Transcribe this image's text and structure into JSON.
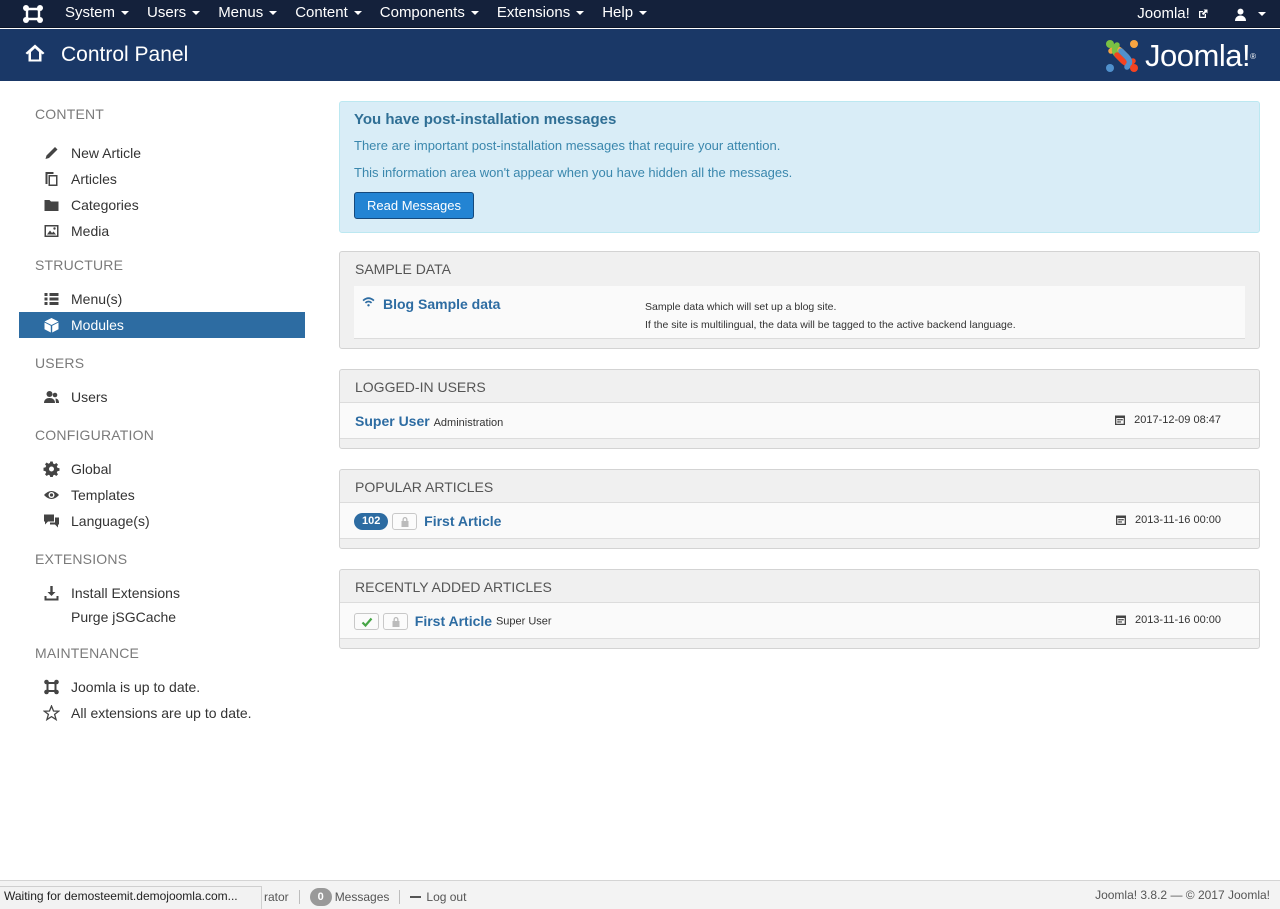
{
  "topnav": {
    "menu": [
      "System",
      "Users",
      "Menus",
      "Content",
      "Components",
      "Extensions",
      "Help"
    ],
    "site_link": "Joomla!"
  },
  "header": {
    "title": "Control Panel",
    "brand": "Joomla!",
    "brand_mark": "®"
  },
  "sidebar": {
    "sections": [
      {
        "heading": "CONTENT",
        "items": [
          {
            "label": "New Article",
            "icon": "pencil-icon"
          },
          {
            "label": "Articles",
            "icon": "copy-icon"
          },
          {
            "label": "Categories",
            "icon": "folder-icon"
          },
          {
            "label": "Media",
            "icon": "image-icon"
          }
        ]
      },
      {
        "heading": "STRUCTURE",
        "items": [
          {
            "label": "Menu(s)",
            "icon": "list-icon"
          },
          {
            "label": "Modules",
            "icon": "cube-icon",
            "active": true
          }
        ]
      },
      {
        "heading": "USERS",
        "items": [
          {
            "label": "Users",
            "icon": "users-icon"
          }
        ]
      },
      {
        "heading": "CONFIGURATION",
        "items": [
          {
            "label": "Global",
            "icon": "gear-icon"
          },
          {
            "label": "Templates",
            "icon": "eye-icon"
          },
          {
            "label": "Language(s)",
            "icon": "comments-icon"
          }
        ]
      },
      {
        "heading": "EXTENSIONS",
        "items": [
          {
            "label": "Install Extensions",
            "icon": "download-icon"
          },
          {
            "label": "Purge jSGCache",
            "icon": ""
          }
        ]
      },
      {
        "heading": "MAINTENANCE",
        "items": [
          {
            "label": "Joomla is up to date.",
            "icon": "joomla-icon"
          },
          {
            "label": "All extensions are up to date.",
            "icon": "star-icon"
          }
        ]
      }
    ]
  },
  "alert": {
    "title": "You have post-installation messages",
    "line1": "There are important post-installation messages that require your attention.",
    "line2": "This information area won't appear when you have hidden all the messages.",
    "button": "Read Messages"
  },
  "sample_data": {
    "heading": "SAMPLE DATA",
    "item_title": "Blog Sample data",
    "desc1": "Sample data which will set up a blog site.",
    "desc2": "If the site is multilingual, the data will be tagged to the active backend language."
  },
  "logged_in": {
    "heading": "LOGGED-IN USERS",
    "user": "Super User",
    "area": "Administration",
    "date": "2017-12-09 08:47"
  },
  "popular": {
    "heading": "POPULAR ARTICLES",
    "hits": "102",
    "title": "First Article",
    "date": "2013-11-16 00:00"
  },
  "recent": {
    "heading": "RECENTLY ADDED ARTICLES",
    "title": "First Article",
    "author": "Super User",
    "date": "2013-11-16 00:00"
  },
  "statusbar": {
    "loading": "Waiting for demosteemit.demojoomla.com...",
    "frag": "rator",
    "messages_count": "0",
    "messages_label": "Messages",
    "logout": "Log out",
    "copyright": "Joomla! 3.8.2 — © 2017 Joomla!"
  }
}
